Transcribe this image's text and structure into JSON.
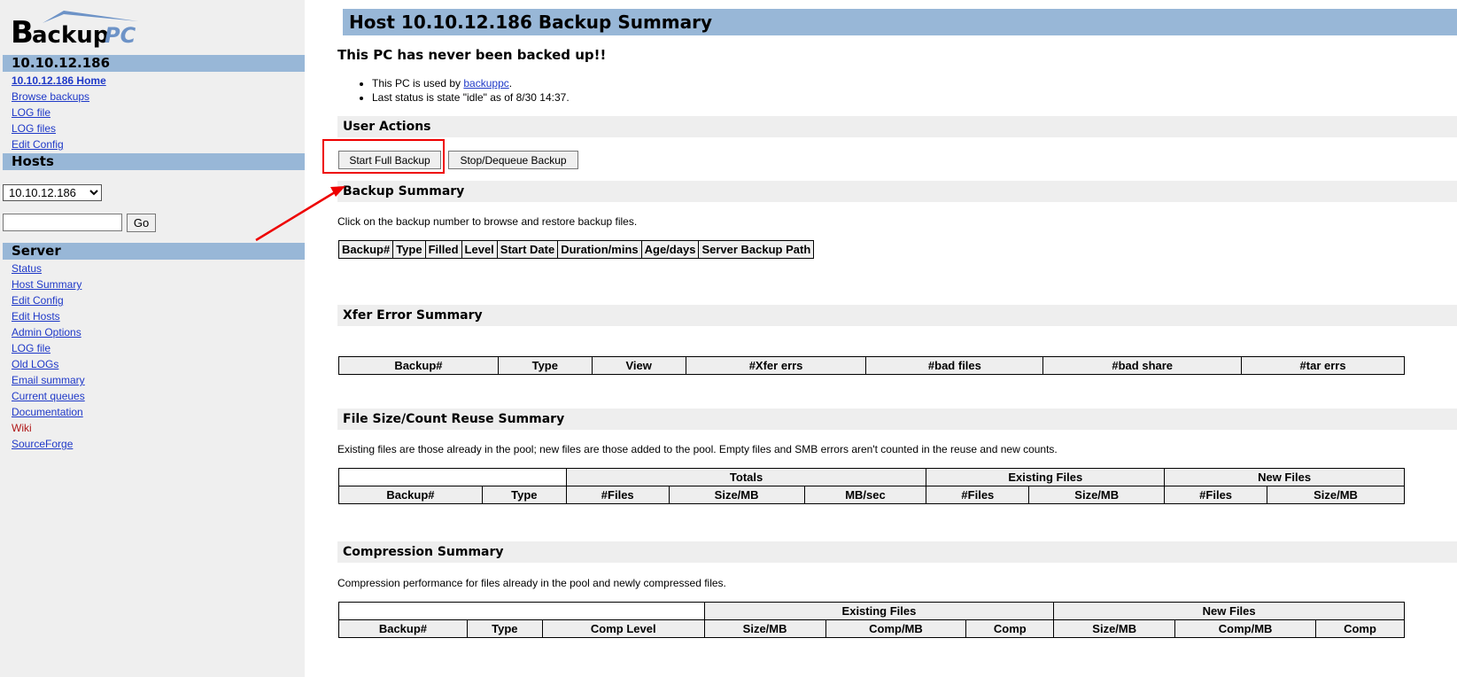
{
  "sidebar": {
    "logo": {
      "text_main": "ackup",
      "text_accent": "PC",
      "letter": "B"
    },
    "host_section": {
      "title": "10.10.12.186",
      "links": [
        "10.10.12.186 Home",
        "Browse backups",
        "LOG file",
        "LOG files",
        "Edit Config"
      ]
    },
    "hosts_section": {
      "title": "Hosts",
      "selected_host": "10.10.12.186",
      "go_label": "Go"
    },
    "server_section": {
      "title": "Server",
      "links": [
        "Status",
        "Host Summary",
        "Edit Config",
        "Edit Hosts",
        "Admin Options",
        "LOG file",
        "Old LOGs",
        "Email summary",
        "Current queues",
        "Documentation",
        "Wiki",
        "SourceForge"
      ]
    }
  },
  "main": {
    "title": "Host 10.10.12.186 Backup Summary",
    "status_heading": "This PC has never been backed up!!",
    "info": {
      "used_by_prefix": "This PC is used by ",
      "used_by_link": "backuppc",
      "used_by_suffix": ".",
      "last_status": "Last status is state \"idle\" as of 8/30 14:37."
    },
    "user_actions": {
      "title": "User Actions",
      "start_full": "Start Full Backup",
      "stop_dequeue": "Stop/Dequeue Backup"
    },
    "backup_summary": {
      "title": "Backup Summary",
      "description": "Click on the backup number to browse and restore backup files.",
      "columns": [
        "Backup#",
        "Type",
        "Filled",
        "Level",
        "Start Date",
        "Duration/mins",
        "Age/days",
        "Server Backup Path"
      ]
    },
    "xfer_summary": {
      "title": "Xfer Error Summary",
      "columns": [
        "Backup#",
        "Type",
        "View",
        "#Xfer errs",
        "#bad files",
        "#bad share",
        "#tar errs"
      ]
    },
    "filesize_summary": {
      "title": "File Size/Count Reuse Summary",
      "description": "Existing files are those already in the pool; new files are those added to the pool. Empty files and SMB errors aren't counted in the reuse and new counts.",
      "groups": [
        "Totals",
        "Existing Files",
        "New Files"
      ],
      "columns": [
        "Backup#",
        "Type",
        "#Files",
        "Size/MB",
        "MB/sec",
        "#Files",
        "Size/MB",
        "#Files",
        "Size/MB"
      ]
    },
    "compression_summary": {
      "title": "Compression Summary",
      "description": "Compression performance for files already in the pool and newly compressed files.",
      "groups": [
        "Existing Files",
        "New Files"
      ],
      "columns": [
        "Backup#",
        "Type",
        "Comp Level",
        "Size/MB",
        "Comp/MB",
        "Comp",
        "Size/MB",
        "Comp/MB",
        "Comp"
      ]
    }
  },
  "colors": {
    "header_blue": "#98b7d7",
    "sidebar_bg": "#efefef",
    "link": "#1f39c8",
    "annotation_red": "#ee0000"
  }
}
